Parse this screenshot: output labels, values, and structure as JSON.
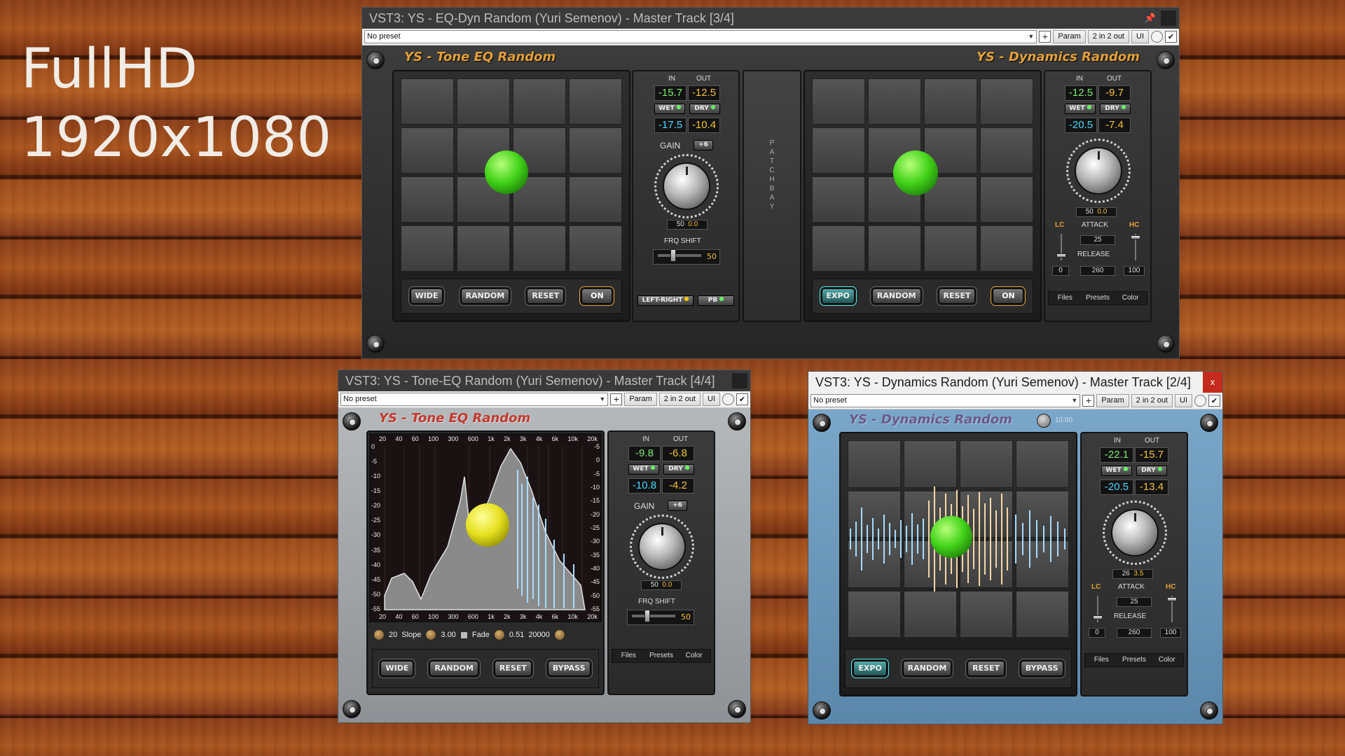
{
  "overlay": {
    "line1": "FullHD",
    "line2": "1920x1080"
  },
  "toolbar_common": {
    "param": "Param",
    "io": "2 in 2 out",
    "ui": "UI",
    "plus": "+",
    "check": "✔"
  },
  "win1": {
    "title": "VST3: YS - EQ-Dyn Random (Yuri Semenov) - Master Track [3/4]",
    "preset": "No preset",
    "left_title": "YS - Tone EQ Random",
    "right_title": "YS - Dynamics Random",
    "left_buttons": [
      "WIDE",
      "RANDOM",
      "RESET",
      "ON"
    ],
    "right_buttons": [
      "EXPO",
      "RANDOM",
      "RESET",
      "ON"
    ],
    "eq_meter": {
      "in_label": "IN",
      "out_label": "OUT",
      "in": "-15.7",
      "out": "-12.5",
      "wet": "WET",
      "dry": "DRY",
      "in2": "-17.5",
      "out2": "-10.4",
      "gain": "GAIN",
      "gain_badge": "+6",
      "k1": "50",
      "k2": "0.0",
      "frq": "FRQ SHIFT",
      "frq_val": "50",
      "lr": "LEFT-RIGHT",
      "pb": "PB"
    },
    "patchbay": [
      "P",
      "A",
      "T",
      "C",
      "H",
      "B",
      "A",
      "Y"
    ],
    "dyn_meter": {
      "in_label": "IN",
      "out_label": "OUT",
      "in": "-12.5",
      "out": "-9.7",
      "wet": "WET",
      "dry": "DRY",
      "in2": "-20.5",
      "out2": "-7.4",
      "k1": "50",
      "k2": "0.0",
      "lc": "LC",
      "attack": "ATTACK",
      "hc": "HC",
      "attack_val": "25",
      "release": "RELEASE",
      "lc_val": "0",
      "release_val": "260",
      "hc_val": "100",
      "tabs": [
        "Files",
        "Presets",
        "Color"
      ]
    }
  },
  "win2": {
    "title": "VST3: YS - Tone-EQ Random (Yuri Semenov) - Master Track [4/4]",
    "preset": "No preset",
    "plugin_title": "YS - Tone EQ Random",
    "freq_labels": [
      "20",
      "40",
      "60",
      "100",
      "300",
      "600",
      "1k",
      "2k",
      "3k",
      "4k",
      "6k",
      "10k",
      "20k"
    ],
    "db_labels": [
      "0",
      "-5",
      "-10",
      "-15",
      "-20",
      "-25",
      "-30",
      "-35",
      "-40",
      "-45",
      "-50",
      "-55"
    ],
    "db_labels_right": [
      "-5",
      "0",
      "-5",
      "-10",
      "-15",
      "-20",
      "-25",
      "-30",
      "-35",
      "-40",
      "-45",
      "-50",
      "-55"
    ],
    "controls": {
      "v1": "20",
      "slope": "Slope",
      "v2": "3.00",
      "fade": "Fade",
      "v3": "0.51",
      "v4": "20000"
    },
    "buttons": [
      "WIDE",
      "RANDOM",
      "RESET",
      "BYPASS"
    ],
    "meter": {
      "in_label": "IN",
      "out_label": "OUT",
      "in": "-9.8",
      "out": "-6.8",
      "wet": "WET",
      "dry": "DRY",
      "in2": "-10.8",
      "out2": "-4.2",
      "gain": "GAIN",
      "gain_badge": "+6",
      "k1": "50",
      "k2": "0.0",
      "frq": "FRQ SHIFT",
      "frq_val": "50",
      "tabs": [
        "Files",
        "Presets",
        "Color"
      ]
    }
  },
  "win3": {
    "title": "VST3: YS - Dynamics Random (Yuri Semenov) - Master Track [2/4]",
    "preset": "No preset",
    "plugin_title": "YS - Dynamics Random",
    "knob_label": "10.00",
    "buttons": [
      "EXPO",
      "RANDOM",
      "RESET",
      "BYPASS"
    ],
    "meter": {
      "in_label": "IN",
      "out_label": "OUT",
      "in": "-22.1",
      "out": "-15.7",
      "wet": "WET",
      "dry": "DRY",
      "in2": "-20.5",
      "out2": "-13.4",
      "k1": "26",
      "k2": "3.5",
      "lc": "LC",
      "attack": "ATTACK",
      "hc": "HC",
      "attack_val": "25",
      "release": "RELEASE",
      "lc_val": "0",
      "release_val": "260",
      "hc_val": "100",
      "tabs": [
        "Files",
        "Presets",
        "Color"
      ]
    }
  }
}
